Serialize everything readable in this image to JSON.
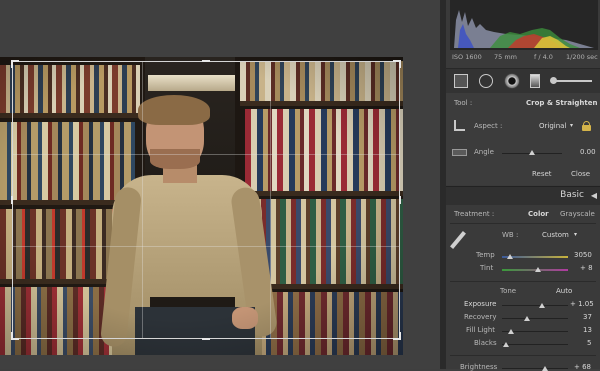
{
  "camera_info": {
    "iso": "ISO 1600",
    "focal_length": "75 mm",
    "aperture": "f / 4.0",
    "shutter": "1/200 sec"
  },
  "crop_panel": {
    "tool_label": "Tool :",
    "tool_value": "Crop & Straighten",
    "aspect_label": "Aspect :",
    "aspect_value": "Original",
    "angle_label": "Angle",
    "angle_value": "0.00",
    "reset_label": "Reset",
    "close_label": "Close"
  },
  "basic_panel": {
    "header_title": "Basic",
    "treatment_label": "Treatment :",
    "treatment_color": "Color",
    "treatment_grayscale": "Grayscale",
    "wb_label": "WB :",
    "wb_value": "Custom",
    "temp_label": "Temp",
    "temp_value": "3050",
    "tint_label": "Tint",
    "tint_value": "+ 8",
    "tone_label": "Tone",
    "tone_auto": "Auto",
    "exposure_label": "Exposure",
    "exposure_value": "+ 1.05",
    "recovery_label": "Recovery",
    "recovery_value": "37",
    "filllight_label": "Fill Light",
    "filllight_value": "13",
    "blacks_label": "Blacks",
    "blacks_value": "5",
    "brightness_label": "Brightness",
    "brightness_value": "+ 68"
  },
  "sliders": {
    "angle": 0.5,
    "temp": 0.12,
    "tint": 0.55,
    "exposure": 0.6,
    "recovery": 0.38,
    "filllight": 0.14,
    "blacks": 0.06,
    "brightness": 0.65
  },
  "icons": {
    "crop_tool": "crop-overlay-icon",
    "spot_removal": "spot-removal-icon",
    "red_eye": "red-eye-icon",
    "graduated_filter": "graduated-filter-icon",
    "brush": "adjustment-brush-icon",
    "lock": "lock-icon",
    "eyedropper": "eyedropper-icon"
  },
  "colors": {
    "panel_bg": "#3a3a3a",
    "canvas_bg": "#404040",
    "crop_border": "#d6d6d6"
  }
}
